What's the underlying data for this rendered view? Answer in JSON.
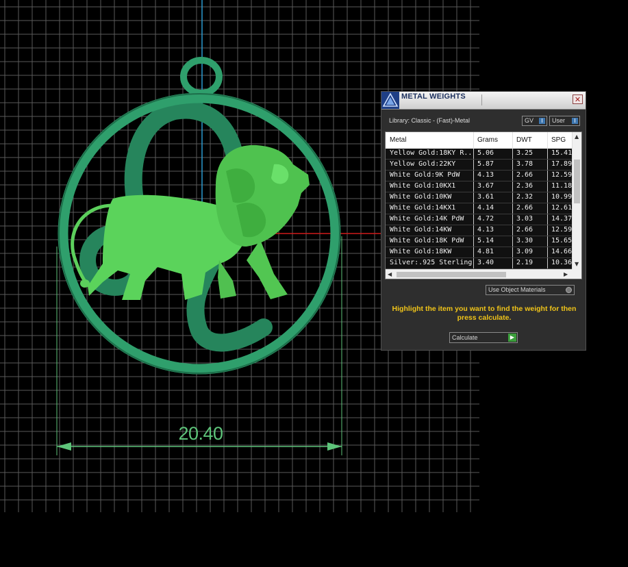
{
  "viewport": {
    "dimension_value": "20.40",
    "colors": {
      "background": "#000000",
      "grid": "#8a8a8a",
      "model": "#2f9f6c",
      "lion": "#5cd45c",
      "dimension": "#5ec47a",
      "axis_y": "#2a9bd0",
      "axis_x": "#d01a1a"
    }
  },
  "panel": {
    "title": "METAL WEIGHTS",
    "close_icon": "close-x-icon",
    "library_label": "Library: Classic - (Fast)-Metal",
    "gv_label": "GV",
    "user_label": "User",
    "columns": [
      "Metal",
      "Grams",
      "DWT",
      "SPG"
    ],
    "rows": [
      [
        "Yellow Gold:18KY R...",
        "5.06",
        "3.25",
        "15.41"
      ],
      [
        "Yellow Gold:22KY",
        "5.87",
        "3.78",
        "17.89"
      ],
      [
        "White Gold:9K PdW",
        "4.13",
        "2.66",
        "12.59"
      ],
      [
        "White Gold:10KX1",
        "3.67",
        "2.36",
        "11.18"
      ],
      [
        "White Gold:10KW",
        "3.61",
        "2.32",
        "10.99"
      ],
      [
        "White Gold:14KX1",
        "4.14",
        "2.66",
        "12.61"
      ],
      [
        "White Gold:14K PdW",
        "4.72",
        "3.03",
        "14.37"
      ],
      [
        "White Gold:14KW",
        "4.13",
        "2.66",
        "12.59"
      ],
      [
        "White Gold:18K PdW",
        "5.14",
        "3.30",
        "15.65"
      ],
      [
        "White Gold:18KW",
        "4.81",
        "3.09",
        "14.66"
      ],
      [
        "Silver:.925 Sterling",
        "3.40",
        "2.19",
        "10.36"
      ]
    ],
    "use_object_materials_label": "Use Object Materials",
    "instructions": "Highlight the item you want to find the weight for then press calculate.",
    "calculate_label": "Calculate",
    "accent_color": "#f0c419"
  }
}
